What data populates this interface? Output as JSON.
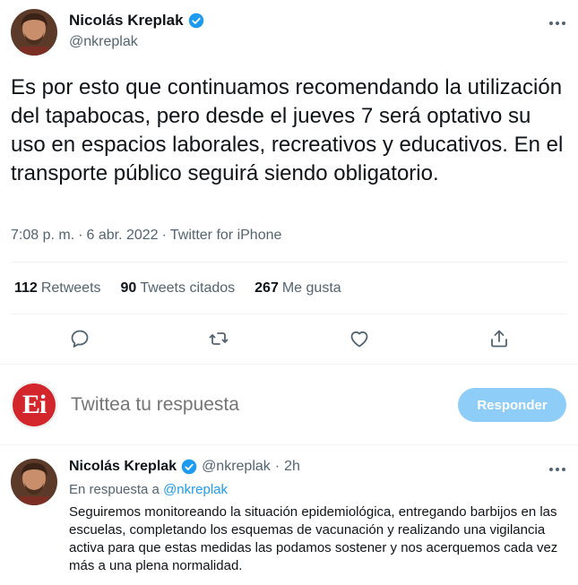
{
  "tweet": {
    "author_name": "Nicolás Kreplak",
    "author_handle": "@nkreplak",
    "text": "Es por esto que continuamos recomendando la utilización del tapabocas, pero desde el jueves 7 será optativo su uso en espacios laborales, recreativos y educativos. En el transporte público seguirá siendo obligatorio.",
    "time": "7:08 p. m.",
    "separator1": "·",
    "date": "6 abr. 2022",
    "separator2": "·",
    "source": "Twitter for iPhone",
    "stats": {
      "retweets_count": "112",
      "retweets_label": "Retweets",
      "quotes_count": "90",
      "quotes_label": "Tweets citados",
      "likes_count": "267",
      "likes_label": "Me gusta"
    },
    "icons": {
      "reply": "reply-icon",
      "retweet": "retweet-icon",
      "like": "heart-icon",
      "share": "share-icon",
      "verified": "verified-badge-icon",
      "more": "more-options-icon"
    }
  },
  "reply_box": {
    "avatar_logo_text": "Ei",
    "placeholder": "Twittea tu respuesta",
    "button_label": "Responder"
  },
  "reply_tweet": {
    "author_name": "Nicolás Kreplak",
    "author_handle": "@nkreplak",
    "separator": "·",
    "time_ago": "2h",
    "in_reply_prefix": "En respuesta a",
    "in_reply_handle": "@nkreplak",
    "text": "Seguiremos monitoreando la situación epidemiológica, entregando barbijos en las escuelas, completando los esquemas de vacunación y realizando una vigilancia activa para que estas medidas las podamos sostener y nos acerquemos cada vez más a una plena normalidad."
  },
  "colors": {
    "accent": "#1d9bf0",
    "button_disabled": "#8ecdf8",
    "secondary_text": "#536471",
    "primary_text": "#0f1419",
    "divider": "#eff3f4",
    "logo_red": "#d3262c"
  }
}
